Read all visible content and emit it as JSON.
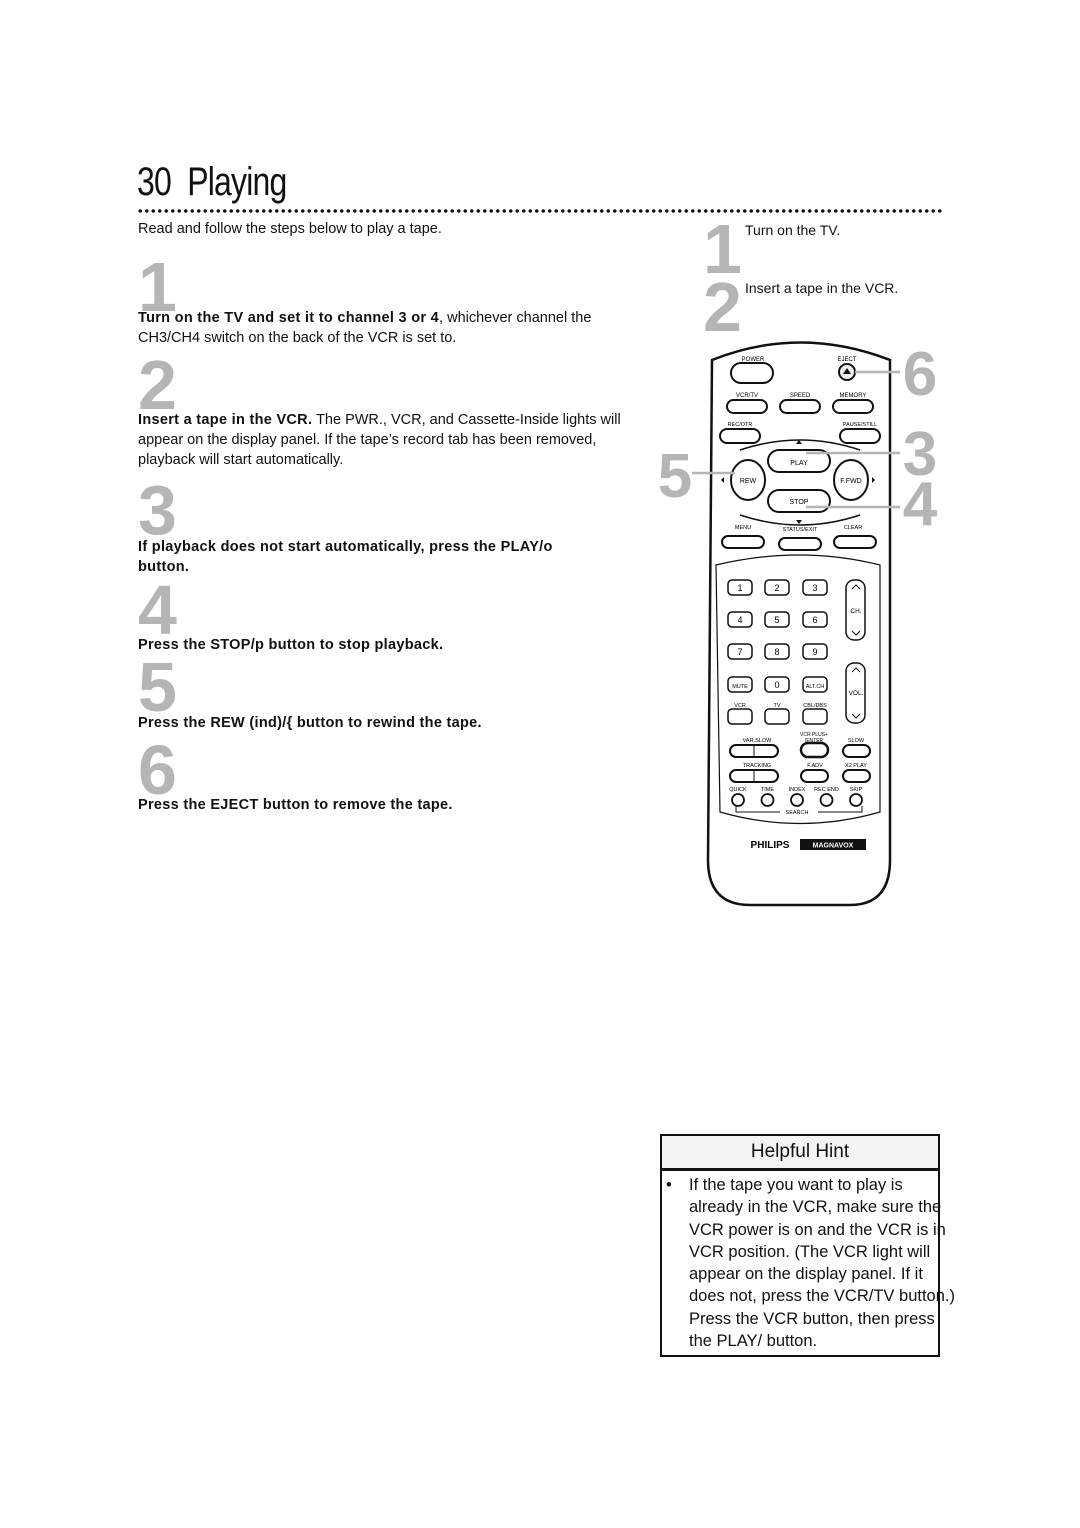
{
  "page": {
    "number": "30",
    "title": "Playing",
    "intro": "Read and follow the steps below to play a tape."
  },
  "steps": [
    {
      "num": "1",
      "bold": "Turn on the TV and set it to channel 3 or 4",
      "rest": ", whichever channel the CH3/CH4 switch on the back of the VCR is set to."
    },
    {
      "num": "2",
      "bold": "Insert a tape in the VCR.",
      "rest": " The PWR., VCR, and Cassette-Inside lights will appear on the display panel. If the tape’s record tab has been removed, playback will start automatically."
    },
    {
      "num": "3",
      "bold": "If playback does not start automatically, press the PLAY/o button.",
      "rest": ""
    },
    {
      "num": "4",
      "bold": "Press the STOP/p button to stop playback.",
      "rest": ""
    },
    {
      "num": "5",
      "bold": "Press the REW (ind)/{ button to rewind the tape.",
      "rest": ""
    },
    {
      "num": "6",
      "bold": "Press the EJECT button to remove the tape.",
      "rest": ""
    }
  ],
  "sidebar_steps": [
    {
      "num": "1",
      "text": "Turn on the TV."
    },
    {
      "num": "2",
      "text": "Insert a tape in the VCR."
    }
  ],
  "remote": {
    "callouts": [
      "6",
      "3",
      "5",
      "4"
    ],
    "labels": {
      "power": "POWER",
      "eject": "EJECT",
      "vcrtv": "VCR/TV",
      "speed": "SPEED",
      "memory": "MEMORY",
      "recotr": "REC/OTR",
      "pause": "PAUSE/STILL",
      "play": "PLAY",
      "rew": "REW",
      "ffwd": "F.FWD",
      "stop": "STOP",
      "menu": "MENU",
      "status": "STATUS/EXIT",
      "clear": "CLEAR",
      "ch": "CH.",
      "vol": "VOL.",
      "mute": "MUTE",
      "altch": "ALT.CH",
      "vcr": "VCR",
      "tv": "TV",
      "cbl": "CBL/DBS",
      "vcrplus1": "VCR PLUS+",
      "vcrplus2": "/ENTER",
      "varslow": "VAR.SLOW",
      "slow": "SLOW",
      "tracking": "TRACKING",
      "fadv": "F.ADV",
      "x2play": "X2 PLAY",
      "quick": "QUICK",
      "time": "TIME",
      "index": "INDEX",
      "recend": "REC END",
      "skip": "SKIP",
      "search": "SEARCH",
      "brand1": "PHILIPS",
      "brand2": "MAGNAVOX"
    },
    "digits": [
      "1",
      "2",
      "3",
      "4",
      "5",
      "6",
      "7",
      "8",
      "9",
      "0"
    ]
  },
  "hint": {
    "title": "Helpful Hint",
    "lines": [
      "If the tape you want to play is",
      "already in the VCR, make sure the",
      "VCR power is on and the VCR is in",
      "VCR position. (The VCR light will",
      "appear on the display panel. If it",
      "does not, press the VCR/TV button.)",
      "Press the VCR button, then press",
      "the PLAY/ button."
    ]
  }
}
